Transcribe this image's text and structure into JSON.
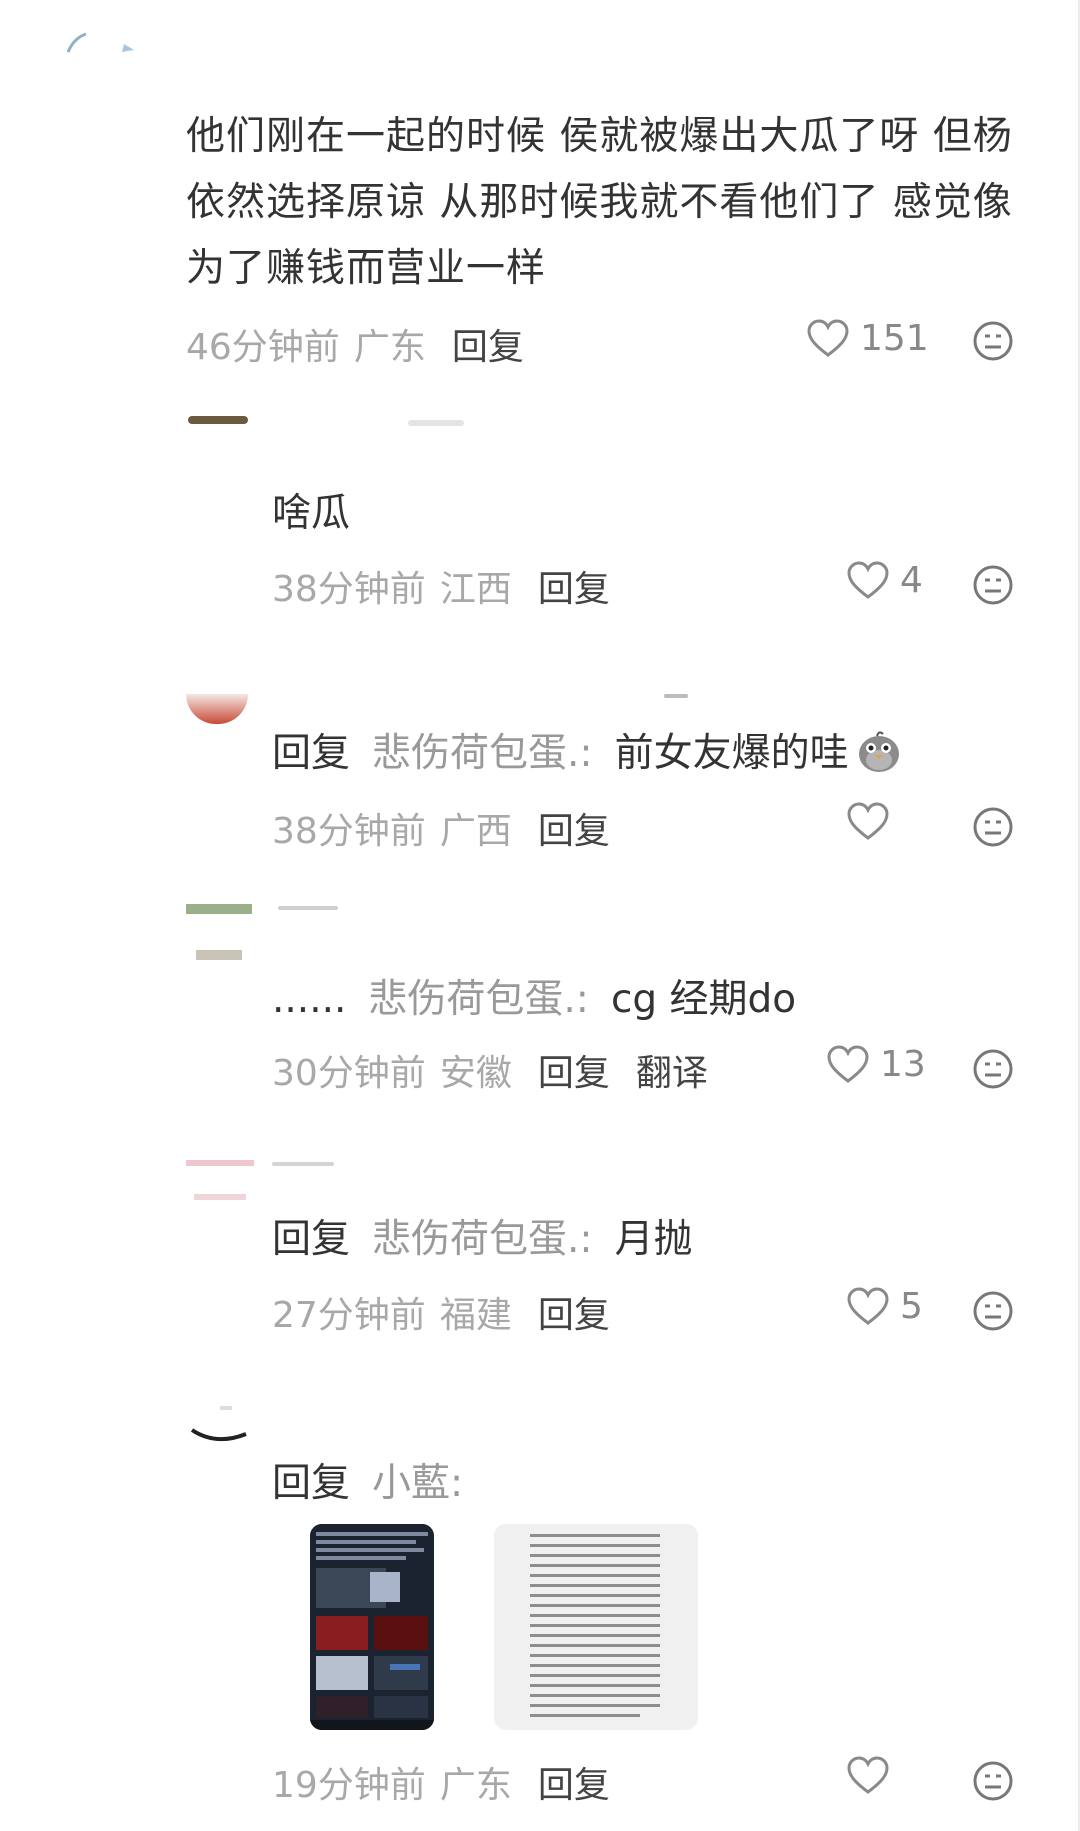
{
  "comments": [
    {
      "text": "他们刚在一起的时候 侯就被爆出大瓜了呀 但杨依然选择原谅 从那时候我就不看他们了 感觉像为了赚钱而营业一样",
      "time": "46分钟前",
      "location": "广东",
      "reply_label": "回复",
      "likes": "151"
    }
  ],
  "replies": [
    {
      "body": "啥瓜",
      "time": "38分钟前",
      "location": "江西",
      "reply_label": "回复",
      "likes": "4"
    },
    {
      "prefix": "回复",
      "target": "悲伤荷包蛋.",
      "colon": ":",
      "body": "前女友爆的哇",
      "time": "38分钟前",
      "location": "广西",
      "reply_label": "回复",
      "likes": ""
    },
    {
      "prefix": "......",
      "target": "悲伤荷包蛋.",
      "colon": ":",
      "body": "cg  经期do",
      "time": "30分钟前",
      "location": "安徽",
      "reply_label": "回复",
      "translate_label": "翻译",
      "likes": "13"
    },
    {
      "prefix": "回复",
      "target": "悲伤荷包蛋.",
      "colon": ":",
      "body": "月抛",
      "time": "27分钟前",
      "location": "福建",
      "reply_label": "回复",
      "likes": "5"
    },
    {
      "prefix": "回复",
      "target": "小藍",
      "colon": ":",
      "time": "19分钟前",
      "location": "广东",
      "reply_label": "回复",
      "likes": ""
    }
  ],
  "icons": {
    "like": "heart-outline-icon",
    "emoji": "meh-face-icon",
    "inline_emoji": "pigeon-emoji"
  },
  "colors": {
    "text": "#333333",
    "meta": "#a8a8a8",
    "target_name": "#999999"
  }
}
